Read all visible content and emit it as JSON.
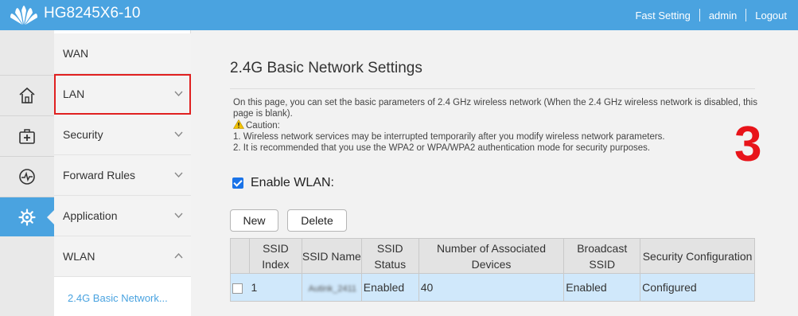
{
  "header": {
    "model": "HG8245X6-10",
    "fast_setting": "Fast Setting",
    "user": "admin",
    "logout": "Logout"
  },
  "icon_rail": [
    {
      "icon": "home-icon",
      "active": false
    },
    {
      "icon": "first-aid-kit-icon",
      "active": false
    },
    {
      "icon": "pulse-monitor-icon",
      "active": false
    },
    {
      "icon": "gear-icon",
      "active": true
    }
  ],
  "menu": {
    "items": [
      {
        "label": "WAN"
      },
      {
        "label": "LAN"
      },
      {
        "label": "Security"
      },
      {
        "label": "Forward Rules"
      },
      {
        "label": "Application"
      },
      {
        "label": "WLAN"
      }
    ],
    "active_sub": "2.4G Basic Network..."
  },
  "page": {
    "title": "2.4G Basic Network Settings",
    "desc_line1": "On this page, you can set the basic parameters of 2.4 GHz wireless network (When the 2.4 GHz wireless network is disabled, this page is blank).",
    "caution_label": "Caution:",
    "caution_1": "1. Wireless network services may be interrupted temporarily after you modify wireless network parameters.",
    "caution_2": "2. It is recommended that you use the WPA2 or WPA/WPA2 authentication mode for security purposes.",
    "step_marker": "3",
    "enable_label": "Enable WLAN:",
    "enable_checked": true,
    "new_label": "New",
    "delete_label": "Delete"
  },
  "table": {
    "headers": [
      "SSID Index",
      "SSID Name",
      "SSID Status",
      "Number of Associated Devices",
      "Broadcast SSID",
      "Security Configuration"
    ],
    "rows": [
      {
        "index": "1",
        "name": "Autink_2411",
        "status": "Enabled",
        "devices": "40",
        "broadcast": "Enabled",
        "security": "Configured"
      }
    ]
  },
  "colors": {
    "brand_blue": "#4aa3e0",
    "highlight_red": "#e02020",
    "step_red": "#e8141a",
    "row_selected": "#d0e8fb"
  }
}
